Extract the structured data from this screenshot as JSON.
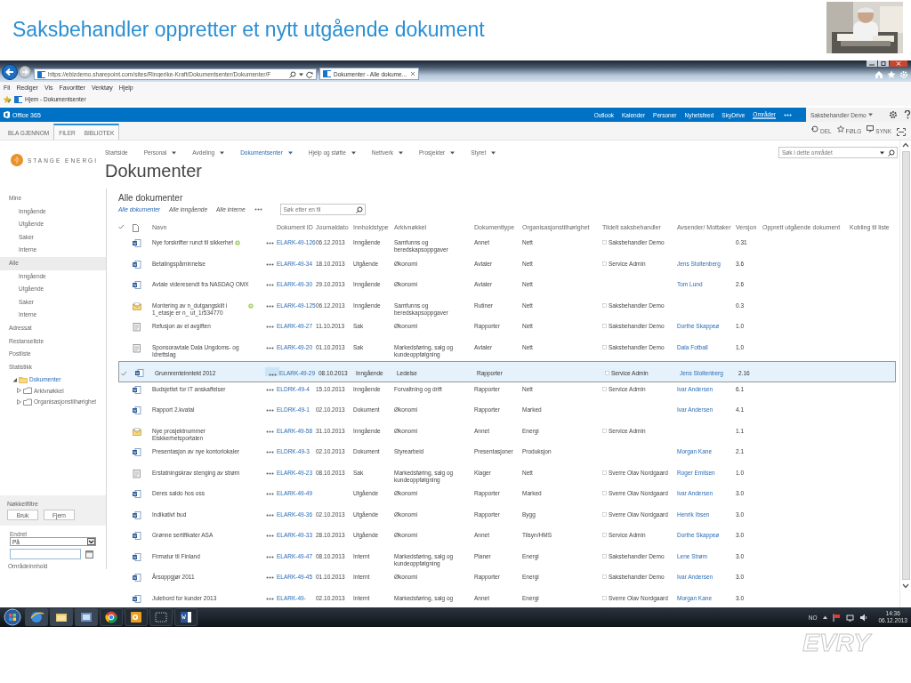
{
  "slide": {
    "title": "Saksbehandler oppretter et nytt utgående dokument",
    "logo": "EVRY"
  },
  "browser": {
    "url": "https://ebizdemo.sharepoint.com/sites/Ringerike-Kraft/Dokumentsenter/Dokumenter/F",
    "tabs": [
      {
        "label": "Dokumenter - Alle dokume...",
        "selected": true
      }
    ],
    "menu": [
      "Fil",
      "Rediger",
      "Vis",
      "Favoritter",
      "Verktøy",
      "Hjelp"
    ],
    "favorites": [
      "Hjem - Dokumentsenter"
    ]
  },
  "suite_bar": {
    "brand": "Office 365",
    "links": [
      {
        "label": "Outlook",
        "selected": false
      },
      {
        "label": "Kalender",
        "selected": false
      },
      {
        "label": "Personer",
        "selected": false
      },
      {
        "label": "Nyhetsfeed",
        "selected": false
      },
      {
        "label": "SkyDrive",
        "selected": false
      },
      {
        "label": "Områder",
        "selected": true
      }
    ],
    "user": "Saksbehandler Demo"
  },
  "ribbon": {
    "tabs": [
      "BLA GJENNOM",
      "FILER",
      "BIBLIOTEK"
    ],
    "actions": [
      "DEL",
      "FØLG",
      "SYNK"
    ]
  },
  "site": {
    "logo": "STANGE ENERGI",
    "nav": [
      {
        "label": "Startside",
        "dropdown": false,
        "selected": false
      },
      {
        "label": "Personal",
        "dropdown": true,
        "selected": false
      },
      {
        "label": "Avdeling",
        "dropdown": true,
        "selected": false
      },
      {
        "label": "Dokumentsenter",
        "dropdown": true,
        "selected": true
      },
      {
        "label": "Hjelp og støtte",
        "dropdown": true,
        "selected": false
      },
      {
        "label": "Nettverk",
        "dropdown": true,
        "selected": false
      },
      {
        "label": "Prosjekter",
        "dropdown": true,
        "selected": false
      },
      {
        "label": "Styret",
        "dropdown": true,
        "selected": false
      }
    ],
    "search_placeholder": "Søk i dette området",
    "title": "Dokumenter"
  },
  "quick_launch": {
    "items": [
      {
        "label": "Mine",
        "selected": false,
        "children": [
          {
            "label": "Inngående"
          },
          {
            "label": "Utgående"
          },
          {
            "label": "Saker"
          },
          {
            "label": "Interne"
          }
        ]
      },
      {
        "label": "Alle",
        "selected": true,
        "children": [
          {
            "label": "Inngående"
          },
          {
            "label": "Utgående"
          },
          {
            "label": "Saker"
          },
          {
            "label": "Interne"
          }
        ]
      },
      {
        "label": "Adressat",
        "selected": false
      },
      {
        "label": "Restanseliste",
        "selected": false
      },
      {
        "label": "Postliste",
        "selected": false
      },
      {
        "label": "Statistikk",
        "selected": false
      }
    ],
    "tree": [
      {
        "label": "Dokumenter",
        "expanded": true,
        "children": [
          {
            "label": "Arkivnøkkel",
            "expanded": false
          },
          {
            "label": "Organisasjonstilhørighet",
            "expanded": false
          }
        ]
      }
    ],
    "key_filters": {
      "title": "Nøkkelfiltre",
      "buttons": [
        "Bruk",
        "Fjern"
      ],
      "field_label": "Endret",
      "select_value": "På"
    },
    "footer_link": "Områdeinnhold"
  },
  "list": {
    "title": "Alle dokumenter",
    "views": [
      {
        "label": "Alle dokumenter",
        "selected": true
      },
      {
        "label": "Alle inngående",
        "selected": false
      },
      {
        "label": "Alle interne",
        "selected": false
      }
    ],
    "search_placeholder": "Søk etter en fil",
    "columns": [
      "Navn",
      "Dokument ID",
      "Journaldato",
      "Innholdstype",
      "Arkivnøkkel",
      "Dokumenttype",
      "Organisasjonstilhørighet",
      "Tildelt saksbehandler",
      "Avsender/ Mottaker",
      "Versjon",
      "Opprett utgående dokument",
      "Kobling til liste"
    ],
    "rows": [
      {
        "kind": "doc",
        "name": "Nye forskrifter runct til sikkerhet",
        "new": true,
        "id": "ELARK-49-126",
        "date": "06.12.2013",
        "content_type": "Inngående",
        "archive_key": "Samfunns og beredskapsoppgaver",
        "doc_type": "Annet",
        "org": "Nett",
        "assignee": "Saksbehandler Demo",
        "version": "0.31",
        "selected": false
      },
      {
        "kind": "doc",
        "name": "Betalingspåminnelse",
        "id": "ELARK-49-34",
        "date": "18.10.2013",
        "content_type": "Utgående",
        "archive_key": "Økonomi",
        "doc_type": "Avtaler",
        "org": "Nett",
        "assignee": "Service Admin",
        "contact": "Jens Stoltenberg",
        "version": "3.6",
        "selected": false
      },
      {
        "kind": "doc",
        "name": "Avtale videresendt fra NASDAQ OMX",
        "id": "ELARK-49-30",
        "date": "29.10.2013",
        "content_type": "Inngående",
        "archive_key": "Økonomi",
        "doc_type": "Avtaler",
        "org": "Nett",
        "contact": "Tom Lund",
        "version": "2.6",
        "selected": false
      },
      {
        "kind": "mail",
        "name": "Montering av n_dutgangskilt i 1_etasje er n_ ut_1r534770",
        "new": true,
        "id": "ELARK-49-125",
        "date": "06.12.2013",
        "content_type": "Inngående",
        "archive_key": "Samfunns og beredskapsoppgaver",
        "doc_type": "Rutiner",
        "org": "Nett",
        "assignee": "Saksbehandler Demo",
        "version": "0.3",
        "selected": false
      },
      {
        "kind": "form",
        "name": "Refusjon av el avgiften",
        "id": "ELARK-49-27",
        "date": "11.10.2013",
        "content_type": "Sak",
        "archive_key": "Økonomi",
        "doc_type": "Rapporter",
        "org": "Nett",
        "assignee": "Saksbehandler Demo",
        "contact": "Dorthe Skappeø",
        "version": "1.0",
        "selected": false
      },
      {
        "kind": "form",
        "name": "Sponsoravtale Dala Ungdoms- og Idrettslag",
        "id": "ELARK-49-20",
        "date": "01.10.2013",
        "content_type": "Sak",
        "archive_key": "Markedsføring, salg og kundeoppfølgning",
        "doc_type": "Avtaler",
        "org": "Nett",
        "assignee": "Saksbehandler Demo",
        "contact": "Dala Fotball",
        "version": "1.0",
        "selected": false
      },
      {
        "kind": "doc",
        "name": "Grunnrenteinntekt 2012",
        "id": "ELARK-49-29",
        "date": "08.10.2013",
        "content_type": "Inngående",
        "archive_key": "Ledelse",
        "doc_type": "Rapporter",
        "assignee": "Service Admin",
        "contact": "Jens Stoltenberg",
        "version": "2.16",
        "selected": true
      },
      {
        "kind": "doc",
        "name": "Budsjettet for IT anskaffelser",
        "id": "ELDRK-49-4",
        "date": "15.10.2013",
        "content_type": "Inngående",
        "archive_key": "Forvaltning og drift",
        "doc_type": "Rapporter",
        "org": "Nett",
        "assignee": "Service Admin",
        "contact": "Ivar Andersen",
        "version": "6.1",
        "selected": false
      },
      {
        "kind": "doc",
        "name": "Rapport 2.kvatal",
        "id": "ELDRK-49-1",
        "date": "02.10.2013",
        "content_type": "Dokument",
        "archive_key": "Økonomi",
        "doc_type": "Rapporter",
        "org": "Marked",
        "contact": "Ivar Andersen",
        "version": "4.1",
        "selected": false
      },
      {
        "kind": "mail",
        "name": "Nye prosjektnummer Eiskkerhetsportalen",
        "id": "ELARK-49-58",
        "date": "31.10.2013",
        "content_type": "Inngående",
        "archive_key": "Økonomi",
        "doc_type": "Annet",
        "org": "Energi",
        "assignee": "Service Admin",
        "version": "1.1",
        "selected": false
      },
      {
        "kind": "doc",
        "name": "Presentasjon av nye kontorlokaler",
        "id": "ELDRK-49-3",
        "date": "02.10.2013",
        "content_type": "Dokument",
        "archive_key": "Styrearbeid",
        "doc_type": "Presentasjoner",
        "org": "Produksjon",
        "contact": "Morgan Kane",
        "version": "2.1",
        "selected": false
      },
      {
        "kind": "form",
        "name": "Erstatningskrav stenging av strøm",
        "id": "ELARK-49-23",
        "date": "08.10.2013",
        "content_type": "Sak",
        "archive_key": "Markedsføring, salg og kundeoppfølgning",
        "doc_type": "Klager",
        "org": "Nett",
        "assignee": "Sverre Olav Nordgaard",
        "contact": "Roger Emilsen",
        "version": "1.0",
        "selected": false
      },
      {
        "kind": "doc",
        "name": "Deres saldo hos oss",
        "id": "ELARK-49-49",
        "content_type": "Utgående",
        "archive_key": "Økonomi",
        "doc_type": "Rapporter",
        "org": "Marked",
        "assignee": "Sverre Olav Nordgaard",
        "contact": "Ivar Andersen",
        "version": "3.0",
        "selected": false
      },
      {
        "kind": "doc",
        "name": "Indikativt bud",
        "id": "ELARK-49-36",
        "date": "02.10.2013",
        "content_type": "Utgående",
        "archive_key": "Økonomi",
        "doc_type": "Rapporter",
        "org": "Bygg",
        "assignee": "Sverre Olav Nordgaard",
        "contact": "Henrik Ibsen",
        "version": "3.0",
        "selected": false
      },
      {
        "kind": "doc",
        "name": "Grønne sertifikater ASA",
        "id": "ELARK-49-33",
        "date": "28.10.2013",
        "content_type": "Utgående",
        "archive_key": "Økonomi",
        "doc_type": "Annet",
        "org": "Tilsyn/HMS",
        "assignee": "Service Admin",
        "contact": "Dorthe Skappeø",
        "version": "3.0",
        "selected": false
      },
      {
        "kind": "doc",
        "name": "Firmatur til Finland",
        "id": "ELARK-49-47",
        "date": "08.10.2013",
        "content_type": "Internt",
        "archive_key": "Markedsføring, salg og kundeoppfølgning",
        "doc_type": "Planer",
        "org": "Energi",
        "assignee": "Saksbehandler Demo",
        "contact": "Lene Strøm",
        "version": "3.0",
        "selected": false
      },
      {
        "kind": "doc",
        "name": "Årsoppgjør 2011",
        "id": "ELARK-49-45",
        "date": "01.10.2013",
        "content_type": "Internt",
        "archive_key": "Økonomi",
        "doc_type": "Rapporter",
        "org": "Energi",
        "assignee": "Saksbehandler Demo",
        "contact": "Ivar Andersen",
        "version": "3.0",
        "selected": false
      },
      {
        "kind": "doc",
        "name": "Julebord for kunder 2013",
        "id": "ELARK-49-",
        "date": "02.10.2013",
        "content_type": "Internt",
        "archive_key": "Markedsføring, salg og",
        "doc_type": "Annet",
        "org": "Energi",
        "assignee": "Sverre Olav Nordgaard",
        "contact": "Morgan Kane",
        "version": "3.0",
        "selected": false
      }
    ]
  },
  "taskbar": {
    "language": "NO",
    "time": "14:36",
    "date": "06.12.2013"
  }
}
